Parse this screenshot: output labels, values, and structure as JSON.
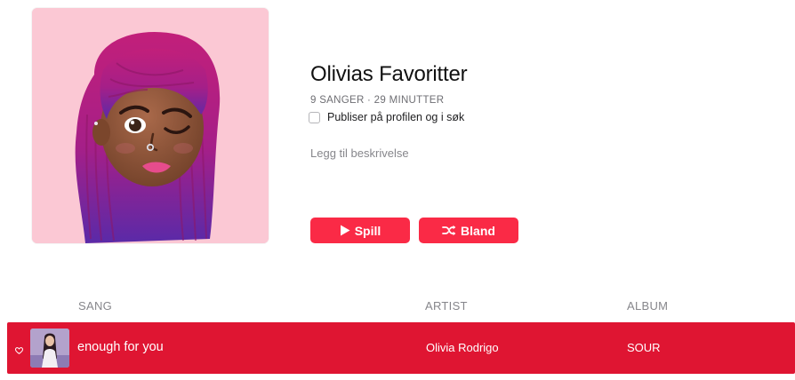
{
  "playlist": {
    "title": "Olivias Favoritter",
    "meta": "9 SANGER · 29 MINUTTER",
    "publish_label": "Publiser på profilen og i søk",
    "publish_checked": false,
    "description_placeholder": "Legg til beskrivelse",
    "artwork_icon": "memoji-avatar"
  },
  "buttons": {
    "play_label": "Spill",
    "play_icon": "play-icon",
    "shuffle_label": "Bland",
    "shuffle_icon": "shuffle-icon"
  },
  "columns": {
    "song": "SANG",
    "artist": "ARTIST",
    "album": "ALBUM"
  },
  "tracks": [
    {
      "title": "enough for you",
      "artist": "Olivia Rodrigo",
      "album": "SOUR",
      "selected": true,
      "icon": "heart-icon"
    }
  ],
  "colors": {
    "accent": "#fa2a46",
    "selected_row": "#df1532",
    "artwork_bg": "#f9c6d2"
  }
}
